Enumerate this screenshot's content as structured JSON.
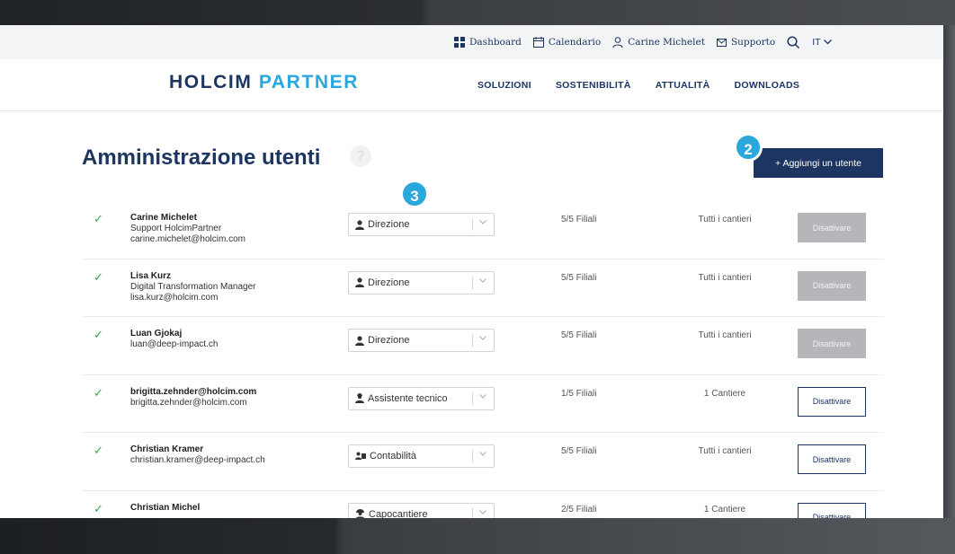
{
  "utility_bar": {
    "items": [
      {
        "label": "Dashboard",
        "icon": "grid-icon"
      },
      {
        "label": "Calendario",
        "icon": "calendar-icon"
      },
      {
        "label": "Carine Michelet",
        "icon": "user-icon"
      },
      {
        "label": "Supporto",
        "icon": "mail-icon"
      }
    ],
    "search_icon": "search-icon",
    "language": "IT"
  },
  "logo": {
    "part1": "HOLCIM",
    "part2": "PARTNER"
  },
  "nav": {
    "items": [
      "SOLUZIONI",
      "SOSTENIBILITÀ",
      "ATTUALITÀ",
      "DOWNLOADS"
    ]
  },
  "page": {
    "title": "Amministrazione utenti",
    "help": "?",
    "add_button": "+  Aggiungi un utente"
  },
  "badges": {
    "add": "2",
    "role": "3"
  },
  "users": [
    {
      "name": "Carine Michelet",
      "line2": "Support HolcimPartner",
      "line3": "carine.michelet@holcim.com",
      "role": "Direzione",
      "filiali": "5/5 Filiali",
      "cantieri": "Tutti i cantieri",
      "button": "Disattivare",
      "button_enabled": false
    },
    {
      "name": "Lisa Kurz",
      "line2": "Digital Transformation Manager",
      "line3": "lisa.kurz@holcim.com",
      "role": "Direzione",
      "filiali": "5/5 Filiali",
      "cantieri": "Tutti i cantieri",
      "button": "Disattivare",
      "button_enabled": false
    },
    {
      "name": "Luan Gjokaj",
      "line2": "luan@deep-impact.ch",
      "line3": "",
      "role": "Direzione",
      "filiali": "5/5 Filiali",
      "cantieri": "Tutti i cantieri",
      "button": "Disattivare",
      "button_enabled": false
    },
    {
      "name": "brigitta.zehnder@holcim.com",
      "line2": "brigitta.zehnder@holcim.com",
      "line3": "",
      "role": "Assistente tecnico",
      "filiali": "1/5 Filiali",
      "cantieri": "1 Cantiere",
      "button": "Disattivare",
      "button_enabled": true
    },
    {
      "name": "Christian Kramer",
      "line2": "christian.kramer@deep-impact.ch",
      "line3": "",
      "role": "Contabilità",
      "filiali": "5/5 Filiali",
      "cantieri": "Tutti i cantieri",
      "button": "Disattivare",
      "button_enabled": true
    },
    {
      "name": "Christian Michel",
      "line2": "",
      "line3": "",
      "role": "Capocantiere",
      "filiali": "2/5 Filiali",
      "cantieri": "1 Cantiere",
      "button": "Disattivare",
      "button_enabled": true
    }
  ],
  "colors": {
    "navy": "#1d3561",
    "accent": "#2aa8dc",
    "check": "#3aa64f",
    "disabled_button": "#b4b6b9"
  }
}
